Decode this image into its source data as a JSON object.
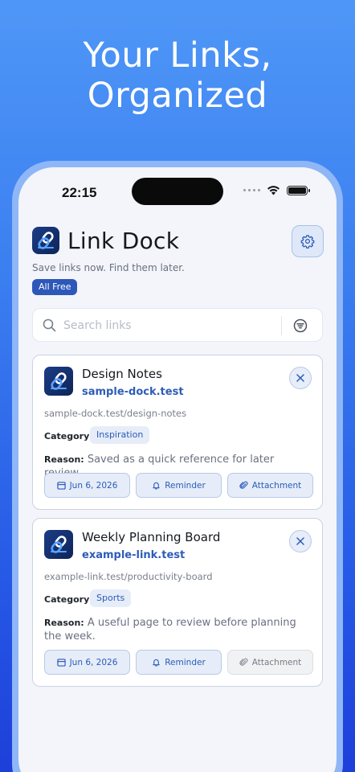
{
  "hero": {
    "line1": "Your Links,",
    "line2": "Organized"
  },
  "status_bar": {
    "time": "22:15"
  },
  "app": {
    "title": "Link Dock",
    "tagline": "Save links now. Find them later.",
    "badge": "All Free",
    "settings_icon": "gear-icon"
  },
  "search": {
    "placeholder": "Search links",
    "value": "",
    "filter_icon": "filter-icon"
  },
  "links": [
    {
      "title": "Design Notes",
      "domain": "sample-dock.test",
      "url": "sample-dock.test/design-notes",
      "category_label": "Category:",
      "category": "Inspiration",
      "reason_label": "Reason:",
      "reason": "Saved as a quick reference for later review.",
      "date": "Jun 6, 2026",
      "reminder": "Reminder",
      "attachment": "Attachment",
      "attachment_enabled": true
    },
    {
      "title": "Weekly Planning Board",
      "domain": "example-link.test",
      "url": "example-link.test/productivity-board",
      "category_label": "Category:",
      "category": "Sports",
      "reason_label": "Reason:",
      "reason": "A useful page to review before planning the week.",
      "date": "Jun 6, 2026",
      "reminder": "Reminder",
      "attachment": "Attachment",
      "attachment_enabled": false
    }
  ],
  "colors": {
    "accent": "#2d58b9",
    "background_top": "#4f97f7",
    "background_bottom": "#1d3fd9",
    "screen": "#f3f5fa"
  }
}
